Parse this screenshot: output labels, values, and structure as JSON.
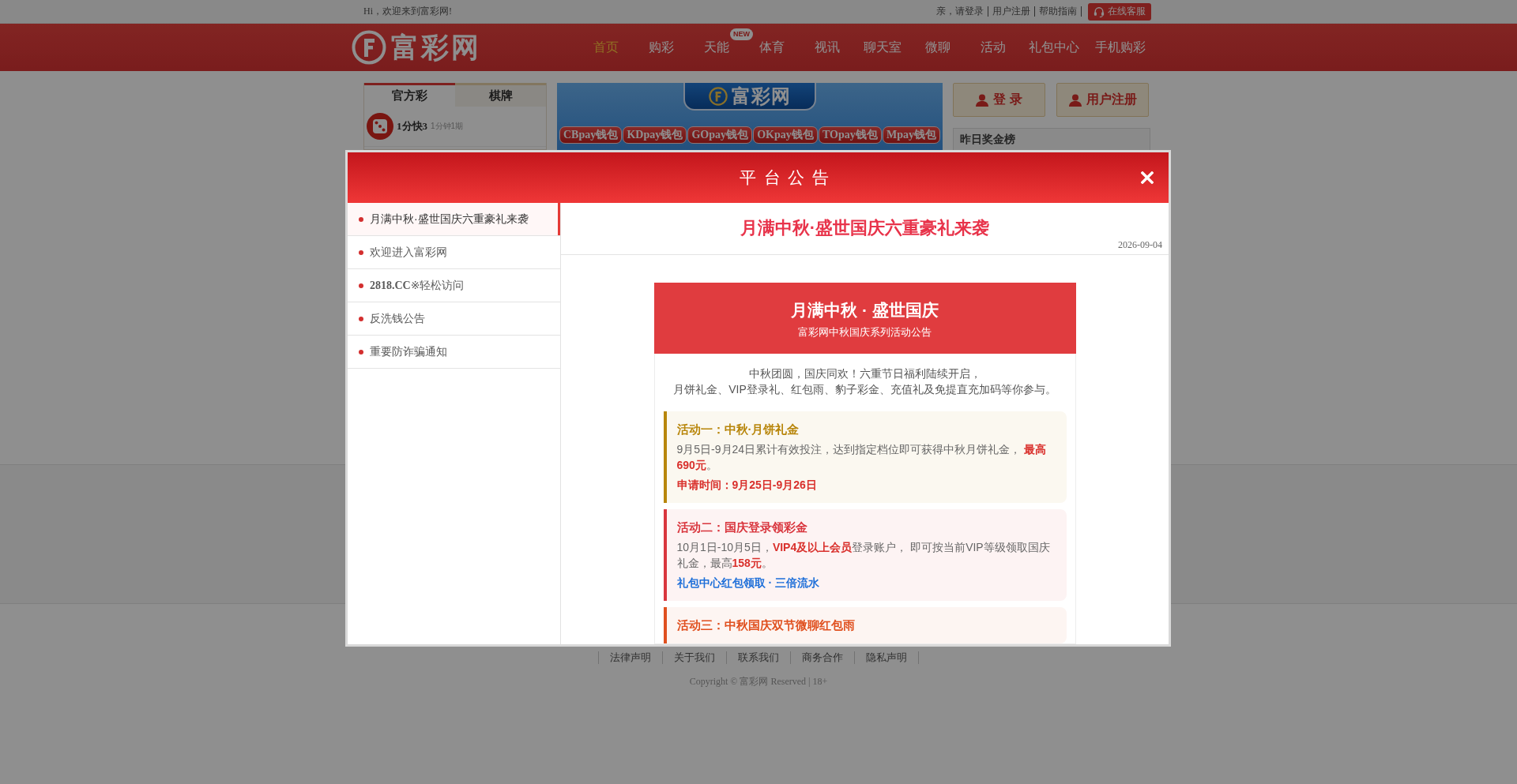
{
  "top_bar": {
    "greeting": "Hi，欢迎来到富彩网!",
    "links": [
      "亲，请登录",
      "用户注册",
      "帮助指南"
    ],
    "service_button": "在线客服"
  },
  "header": {
    "logo": "富彩网",
    "nav": [
      {
        "label": "首页",
        "selected": true
      },
      {
        "label": "购彩",
        "selected": false
      },
      {
        "label": "天能",
        "selected": false,
        "badge": "NEW"
      },
      {
        "label": "体育",
        "selected": false
      },
      {
        "label": "视讯",
        "selected": false
      },
      {
        "label": "聊天室",
        "selected": false
      },
      {
        "label": "微聊",
        "selected": false
      },
      {
        "label": "活动",
        "selected": false
      },
      {
        "label": "礼包中心",
        "selected": false
      },
      {
        "label": "手机购彩",
        "selected": false
      }
    ]
  },
  "lottery_panel": {
    "tabs": [
      {
        "label": "官方彩",
        "selected": true
      },
      {
        "label": "棋牌",
        "selected": false
      }
    ],
    "games": [
      {
        "name": "1分快3",
        "period": "1分钟1期"
      }
    ]
  },
  "banner": {
    "logo": "富彩网",
    "wallets": [
      "CBpay钱包",
      "KDpay钱包",
      "GOpay钱包",
      "OKpay钱包",
      "TOpay钱包",
      "Mpay钱包"
    ]
  },
  "account": {
    "buttons": [
      "登 录",
      "用户注册"
    ],
    "ranking_title": "昨日奖金榜"
  },
  "modal": {
    "title": "平 台 公 告",
    "notices": [
      {
        "title": "月满中秋·盛世国庆六重豪礼来袭",
        "selected": true
      },
      {
        "title": "欢迎进入富彩网",
        "selected": false
      },
      {
        "title": "**2818.CC**※轻松访问",
        "selected": false
      },
      {
        "title": "反洗钱公告",
        "selected": false
      },
      {
        "title": "重要防诈骗通知",
        "selected": false
      }
    ],
    "article": {
      "title": "月满中秋·盛世国庆六重豪礼来袭",
      "date": "2026-09-04",
      "card": {
        "title": "月满中秋 · 盛世国庆",
        "subtitle": "富彩网中秋国庆系列活动公告",
        "intro": [
          "中秋团圆，国庆同欢！六重节日福利陆续开启，",
          "月饼礼金、VIP登录礼、红包雨、豹子彩金、充值礼及免提直充加码等你参与。"
        ],
        "activities": [
          {
            "title": "活动一：中秋·月饼礼金",
            "color": "#b8860b",
            "lines": [
              {
                "kind": "text",
                "text": "9月5日-9月24日累计有效投注，达到指定档位即可获得中秋月饼礼金， **最高690元**。"
              },
              {
                "kind": "alert",
                "text": "申请时间：9月25日-9月26日"
              }
            ]
          },
          {
            "title": "活动二：国庆登录领彩金",
            "color": "#d9363e",
            "lines": [
              {
                "kind": "text",
                "text": "10月1日-10月5日，**VIP4及以上会员**登录账户， 即可按当前VIP等级领取国庆礼金，最高**158元**。"
              },
              {
                "kind": "info",
                "text": "礼包中心红包领取 · 三倍流水"
              }
            ]
          },
          {
            "title": "活动三：中秋国庆双节微聊红包雨",
            "color": "#e0501f"
          }
        ]
      }
    }
  },
  "footer": {
    "links": [
      "法律声明",
      "关于我们",
      "联系我们",
      "商务合作",
      "隐私声明"
    ],
    "copyright": "Copyright © 富彩网 Reserved | 18+"
  }
}
